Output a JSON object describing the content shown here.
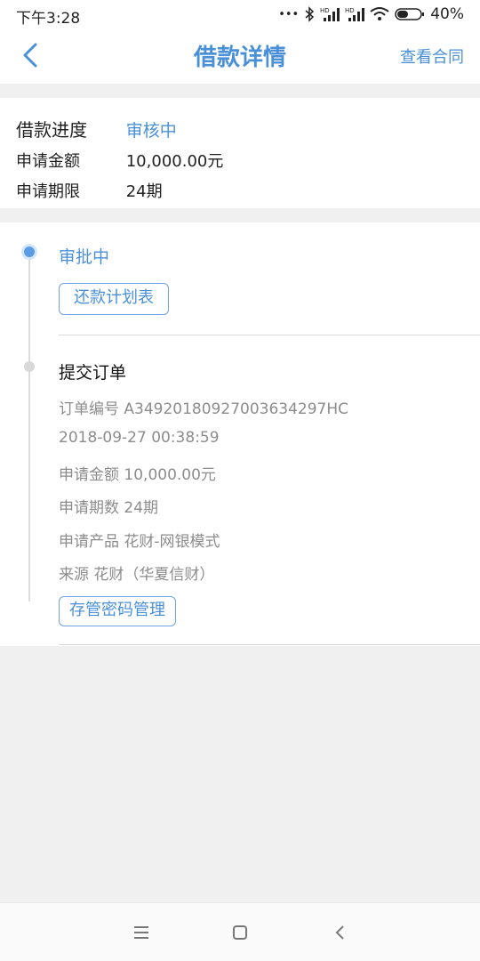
{
  "status_bar": {
    "time": "下午3:28",
    "signal_label": "HD",
    "battery": "40%"
  },
  "header": {
    "title": "借款详情",
    "action": "查看合同"
  },
  "summary": {
    "progress_label": "借款进度",
    "progress_value": "审核中",
    "amount_label": "申请金额",
    "amount_value": "10,000.00元",
    "term_label": "申请期限",
    "term_value": "24期"
  },
  "timeline": {
    "step1": {
      "title": "审批中",
      "button": "还款计划表"
    },
    "step2": {
      "title": "提交订单",
      "order_no": "订单编号 A3492018092700363429 7HC",
      "order_no_text": "订单编号  A34920180927003634297HC",
      "datetime": "2018-09-27 00:38:59",
      "amount": "申请金额  10,000.00元",
      "term": "申请期数  24期",
      "product": "申请产品  花财-网银模式",
      "source": "来源  花财（华夏信财）",
      "button": "存管密码管理"
    }
  },
  "colors": {
    "accent": "#4a90d9",
    "background": "#f0f0f0"
  }
}
